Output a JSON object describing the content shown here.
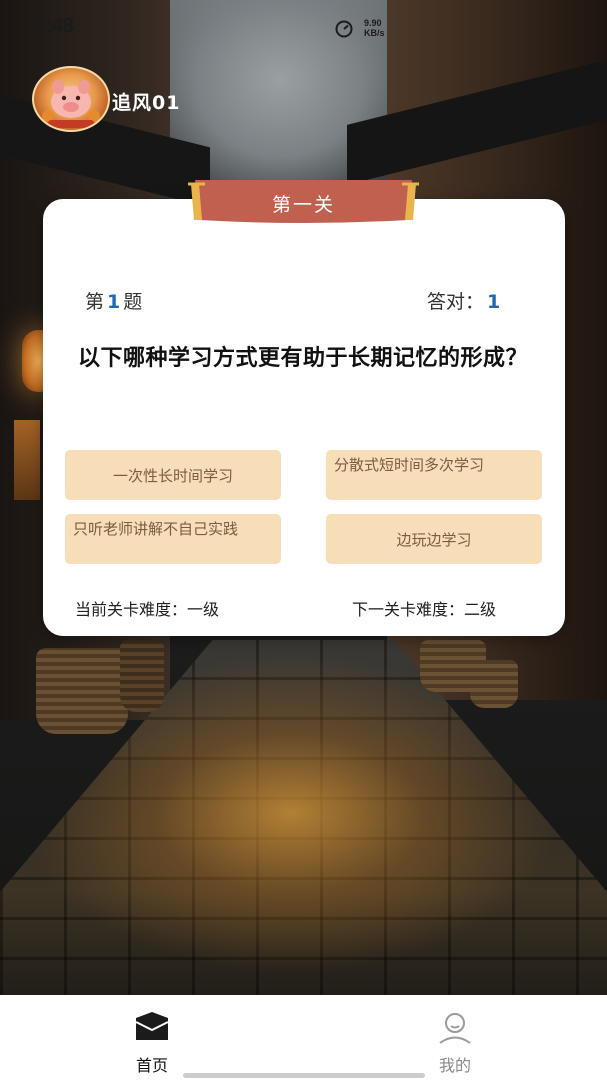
{
  "status_bar": {
    "time": "0:48",
    "net_speed_value": "9.90",
    "net_speed_unit": "KB/s"
  },
  "user": {
    "name": "追风01"
  },
  "level": {
    "title": "第一关"
  },
  "question": {
    "index_prefix": "第",
    "index_number": "1",
    "index_suffix": "题",
    "correct_label": "答对：",
    "correct_count": "1",
    "text": "以下哪种学习方式更有助于长期记忆的形成？"
  },
  "options": [
    "一次性长时间学习",
    "分散式短时间多次学习",
    "只听老师讲解不自己实践",
    "边玩边学习"
  ],
  "difficulty": {
    "current": "当前关卡难度：一级",
    "next": "下一关卡难度：二级"
  },
  "nav": {
    "home": "首页",
    "mine": "我的"
  },
  "colors": {
    "accent_blue": "#1c69b6",
    "option_bg": "#f8deb8",
    "option_text": "#7b5c3c",
    "ribbon": "#c0614f",
    "ribbon_trim": "#e9b44c"
  }
}
